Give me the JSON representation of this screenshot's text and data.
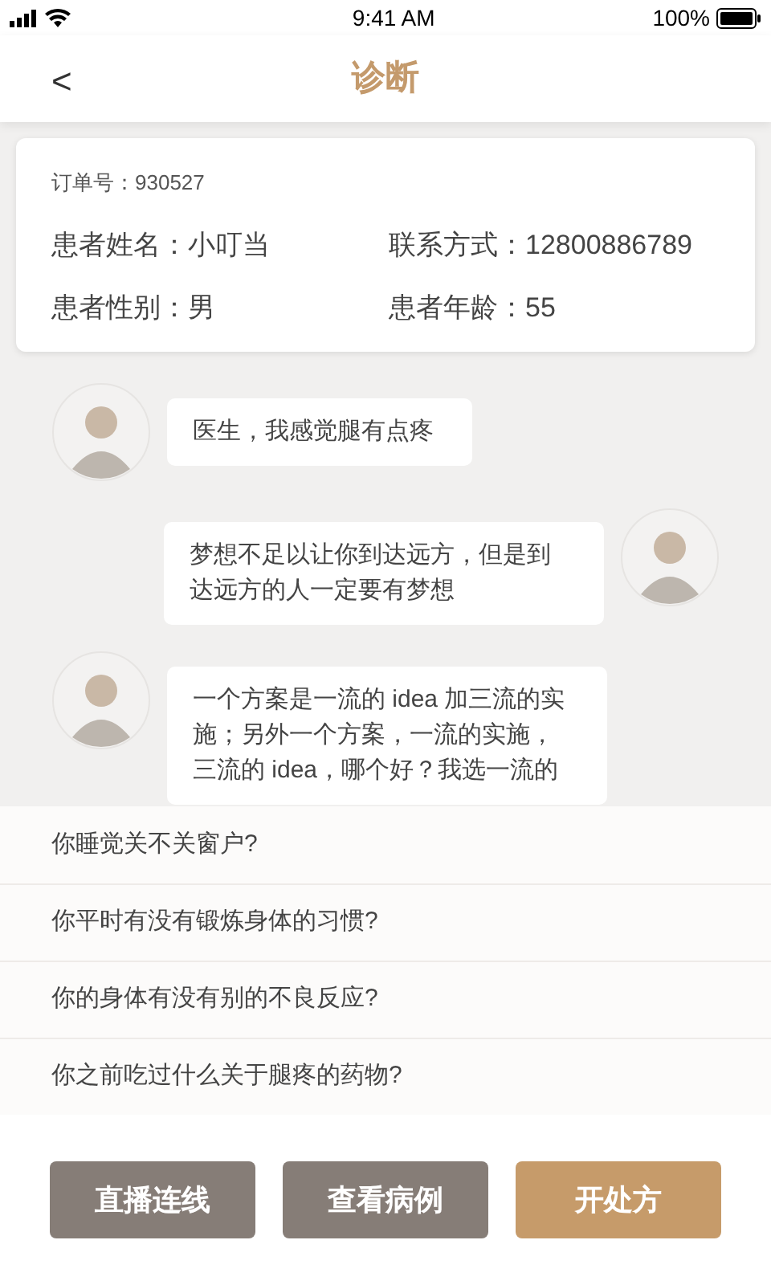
{
  "status_bar": {
    "time": "9:41 AM",
    "battery": "100%"
  },
  "header": {
    "back": "<",
    "title": "诊断"
  },
  "order": {
    "label": "订单号：",
    "value": "930527"
  },
  "patient_fields": [
    {
      "label": "患者姓名：",
      "value": "小叮当"
    },
    {
      "label": "联系方式：",
      "value": "12800886789"
    },
    {
      "label": "患者性别：",
      "value": "男"
    },
    {
      "label": "患者年龄：",
      "value": "55"
    }
  ],
  "messages": [
    {
      "kind": "incoming",
      "text": "医生，我感觉腿有点疼"
    },
    {
      "kind": "outgoing",
      "text": "梦想不足以让你到达远方，但是到达远方的人一定要有梦想"
    },
    {
      "kind": "incoming",
      "text": "一个方案是一流的 idea 加三流的实施；另外一个方案，一流的实施，三流的 idea，哪个好？我选一流的"
    }
  ],
  "quick_questions": [
    "你睡觉关不关窗户?",
    "你平时有没有锻炼身体的习惯?",
    "你的身体有没有别的不良反应?",
    "你之前吃过什么关于腿疼的药物?"
  ],
  "buttons": [
    {
      "label": "直播连线",
      "kind": "secondary"
    },
    {
      "label": "查看病例",
      "kind": "secondary"
    },
    {
      "label": "开处方",
      "kind": "primary"
    }
  ]
}
